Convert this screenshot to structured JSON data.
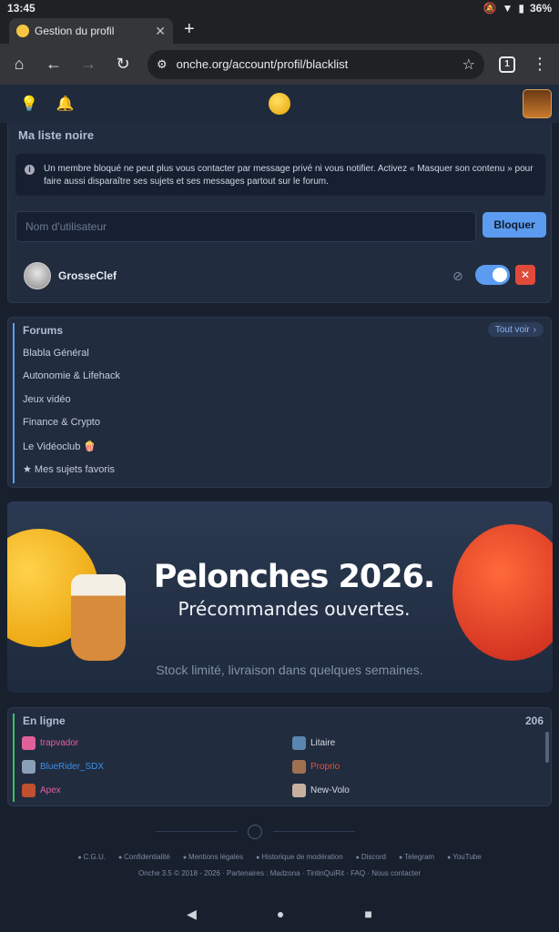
{
  "status": {
    "time": "13:45",
    "battery": "36%"
  },
  "browser": {
    "tab_title": "Gestion du profil",
    "url": "onche.org/account/profil/blacklist",
    "tab_count": "1"
  },
  "blacklist": {
    "title": "Ma liste noire",
    "info": "Un membre bloqué ne peut plus vous contacter par message privé ni vous notifier. Activez « Masquer son contenu » pour faire aussi disparaître ses sujets et ses messages partout sur le forum.",
    "input_placeholder": "Nom d'utilisateur",
    "block_label": "Bloquer",
    "blocked_user": "GrosseClef"
  },
  "forums": {
    "title": "Forums",
    "see_all": "Tout voir",
    "items": [
      "Blabla Général",
      "Autonomie & Lifehack",
      "Jeux vidéo",
      "Finance & Crypto",
      "Le Vidéoclub 🍿",
      "★ Mes sujets favoris"
    ]
  },
  "banner": {
    "headline": "Pelonches 2026.",
    "subheadline": "Précommandes ouvertes.",
    "note": "Stock limité, livraison dans quelques semaines."
  },
  "online": {
    "title": "En ligne",
    "count": "206",
    "users": [
      {
        "name": "trapvador",
        "color": "#e0609a"
      },
      {
        "name": "Litaire",
        "color": "#d5dbe6"
      },
      {
        "name": "BlueRider_SDX",
        "color": "#3d8fe8"
      },
      {
        "name": "Proprio",
        "color": "#e8503a"
      },
      {
        "name": "Apex",
        "color": "#e0609a"
      },
      {
        "name": "New-Volo",
        "color": "#d5dbe6"
      }
    ]
  },
  "footer": {
    "links": [
      "C.G.U.",
      "Confidentialité",
      "Mentions légales",
      "Historique de modération",
      "Discord",
      "Telegram",
      "YouTube"
    ],
    "copyright": "Onche 3.5 © 2018 - 2026 · Partenaires : Madzona · TintinQuiRit · FAQ · Nous contacter"
  }
}
